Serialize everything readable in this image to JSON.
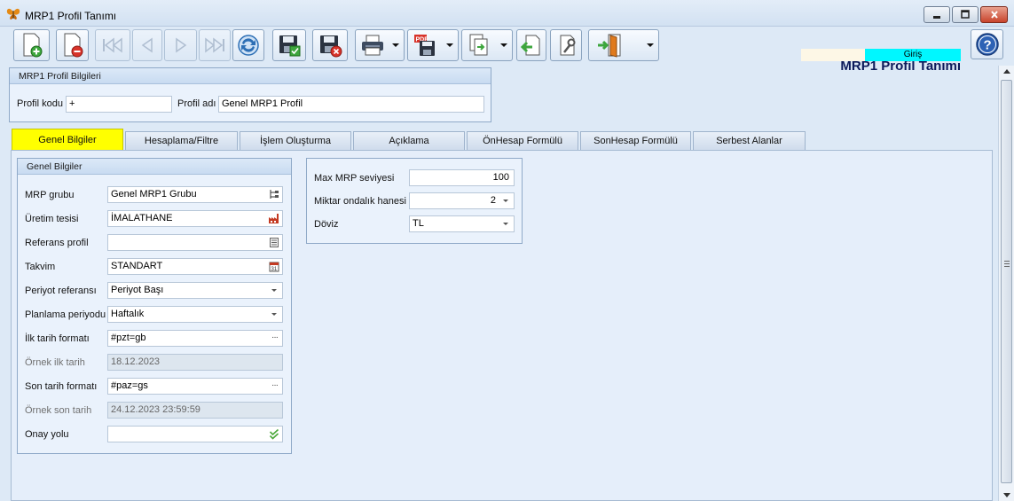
{
  "window": {
    "title": "MRP1 Profil Tanımı"
  },
  "header": {
    "form_title": "MRP1 Profil Tanımı",
    "mode": "Giriş"
  },
  "toolbar": {
    "buttons": [
      {
        "name": "new-record",
        "icon": "new-document-icon",
        "enabled": true
      },
      {
        "name": "delete-record",
        "icon": "delete-document-icon",
        "enabled": true
      },
      {
        "name": "first-record",
        "icon": "first-icon",
        "enabled": false
      },
      {
        "name": "previous-record",
        "icon": "previous-icon",
        "enabled": false
      },
      {
        "name": "next-record",
        "icon": "next-icon",
        "enabled": false
      },
      {
        "name": "last-record",
        "icon": "last-icon",
        "enabled": false
      },
      {
        "name": "refresh",
        "icon": "refresh-icon",
        "enabled": true
      },
      {
        "name": "save",
        "icon": "save-icon",
        "enabled": true
      },
      {
        "name": "save-cancel",
        "icon": "save-cancel-icon",
        "enabled": true
      },
      {
        "name": "print",
        "icon": "printer-icon",
        "enabled": true
      },
      {
        "name": "pdf-save",
        "icon": "pdf-icon",
        "enabled": true
      },
      {
        "name": "export",
        "icon": "export-icon",
        "enabled": true
      },
      {
        "name": "import",
        "icon": "import-icon",
        "enabled": true
      },
      {
        "name": "tools",
        "icon": "tools-icon",
        "enabled": true
      },
      {
        "name": "exit",
        "icon": "exit-door-icon",
        "enabled": true
      }
    ]
  },
  "profile_info": {
    "title": "MRP1 Profil Bilgileri",
    "code_label": "Profil kodu",
    "code_value": "+",
    "name_label": "Profil adı",
    "name_value": "Genel MRP1 Profil"
  },
  "tabs": [
    {
      "label": "Genel Bilgiler",
      "active": true
    },
    {
      "label": "Hesaplama/Filtre"
    },
    {
      "label": "İşlem Oluşturma"
    },
    {
      "label": "Açıklama"
    },
    {
      "label": "ÖnHesap Formülü"
    },
    {
      "label": "SonHesap Formülü"
    },
    {
      "label": "Serbest Alanlar"
    }
  ],
  "general": {
    "title": "Genel Bilgiler",
    "fields": [
      {
        "label": "MRP grubu",
        "value": "Genel MRP1 Grubu",
        "icon": "tree-icon"
      },
      {
        "label": "Üretim tesisi",
        "value": "İMALATHANE",
        "icon": "factory-icon"
      },
      {
        "label": "Referans profil",
        "value": "",
        "icon": "list-icon"
      },
      {
        "label": "Takvim",
        "value": "STANDART",
        "icon": "calendar-icon"
      },
      {
        "label": "Periyot referansı",
        "value": "Periyot Başı",
        "icon": "dropdown"
      },
      {
        "label": "Planlama periyodu",
        "value": "Haftalık",
        "icon": "dropdown"
      },
      {
        "label": "İlk tarih formatı",
        "value": "#pzt=gb",
        "icon": "ellipsis"
      },
      {
        "label": "Örnek ilk tarih",
        "value": "18.12.2023",
        "readonly": true
      },
      {
        "label": "Son tarih formatı",
        "value": "#paz=gs",
        "icon": "ellipsis"
      },
      {
        "label": "Örnek son tarih",
        "value": "24.12.2023 23:59:59",
        "readonly": true
      },
      {
        "label": "Onay yolu",
        "value": "",
        "icon": "check-icon"
      }
    ]
  },
  "mrp_settings": {
    "max_level_label": "Max MRP seviyesi",
    "max_level_value": "100",
    "decimals_label": "Miktar ondalık hanesi",
    "decimals_value": "2",
    "currency_label": "Döviz",
    "currency_value": "TL"
  },
  "colors": {
    "active_tab": "#ffff00",
    "mode_badge": "#00f7ff",
    "title_text": "#0c1a5a"
  }
}
